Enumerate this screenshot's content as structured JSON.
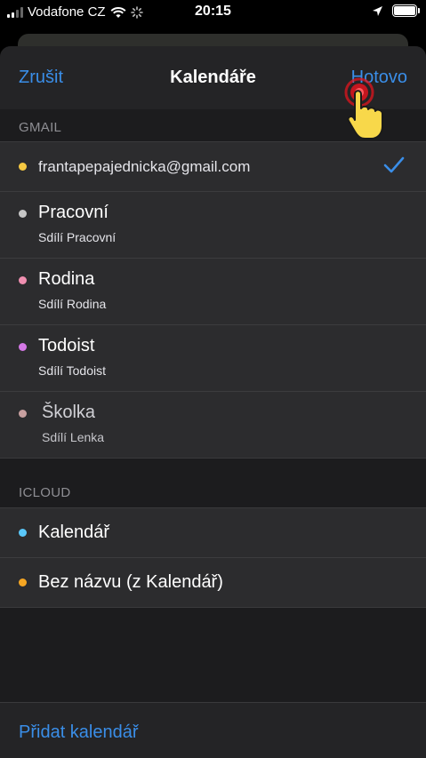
{
  "status_bar": {
    "carrier": "Vodafone CZ",
    "time": "20:15"
  },
  "sheet": {
    "cancel_label": "Zrušit",
    "title": "Kalendáře",
    "done_label": "Hotovo",
    "add_calendar_label": "Přidat kalendář"
  },
  "sections": [
    {
      "header": "GMAIL",
      "calendars": [
        {
          "name": "frantapepajednicka@gmail.com",
          "subtitle": "",
          "color": "#f5c842",
          "checked": true
        },
        {
          "name": "Pracovní",
          "subtitle": "Sdílí Pracovní",
          "color": "#c7c7c7",
          "checked": false
        },
        {
          "name": "Rodina",
          "subtitle": "Sdílí Rodina",
          "color": "#f08fb0",
          "checked": false
        },
        {
          "name": "Todoist",
          "subtitle": "Sdílí Todoist",
          "color": "#d478e6",
          "checked": false
        },
        {
          "name": "Školka",
          "subtitle": "Sdílí Lenka",
          "color": "#c8a0a0",
          "checked": false
        }
      ]
    },
    {
      "header": "ICLOUD",
      "calendars": [
        {
          "name": "Kalendář",
          "subtitle": "",
          "color": "#5ac8fa",
          "checked": false
        },
        {
          "name": "Bez názvu (z Kalendář)",
          "subtitle": "",
          "color": "#f5a623",
          "checked": false
        }
      ]
    }
  ],
  "colors": {
    "accent": "#3a8ee8",
    "sheet_background": "#1c1c1e",
    "row_background": "#2c2c2e",
    "tap_indicator": "#e0141e",
    "hand_cursor": "#f8d84a"
  }
}
